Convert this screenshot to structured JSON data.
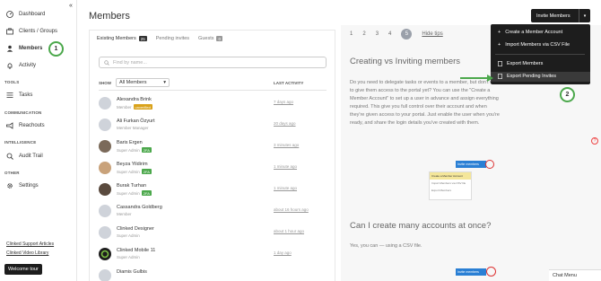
{
  "sidebar": {
    "items": [
      {
        "label": "Dashboard",
        "icon": "dashboard-icon"
      },
      {
        "label": "Clients / Groups",
        "icon": "briefcase-icon"
      },
      {
        "label": "Members",
        "icon": "user-icon"
      },
      {
        "label": "Activity",
        "icon": "bell-icon"
      }
    ],
    "sections": {
      "tools": {
        "label": "TOOLS",
        "items": [
          {
            "label": "Tasks",
            "icon": "list-icon"
          }
        ]
      },
      "communication": {
        "label": "COMMUNICATION",
        "items": [
          {
            "label": "Reachouts",
            "icon": "megaphone-icon"
          }
        ]
      },
      "intelligence": {
        "label": "INTELLIGENCE",
        "items": [
          {
            "label": "Audit Trail",
            "icon": "audit-icon"
          }
        ]
      },
      "other": {
        "label": "OTHER",
        "items": [
          {
            "label": "Settings",
            "icon": "gear-icon"
          }
        ]
      }
    },
    "links": [
      "Clinked Support Articles",
      "Clinked Video Library"
    ],
    "welcome": "Welcome tour",
    "step1": "1"
  },
  "main": {
    "title": "Members",
    "tabs": [
      {
        "label": "Existing Members",
        "count": "25"
      },
      {
        "label": "Pending invites",
        "count": ""
      },
      {
        "label": "Guests",
        "count": "0"
      }
    ],
    "search_placeholder": "Find by name...",
    "show_label": "SHOW",
    "show_value": "All Members",
    "last_activity_header": "LAST ACTIVITY",
    "members": [
      {
        "name": "Alexandra Brink",
        "role": "Member",
        "tag": "unverified",
        "last": "7 days ago"
      },
      {
        "name": "Ali Furkan Özyurt",
        "role": "Member Manager",
        "tag": "",
        "last": "20 days ago"
      },
      {
        "name": "Baris Ergen",
        "role": "Super Admin",
        "tag": "2FA",
        "last": "3 minutes ago"
      },
      {
        "name": "Beyza Yildirim",
        "role": "Super Admin",
        "tag": "2FA",
        "last": "1 minute ago"
      },
      {
        "name": "Burak Turhan",
        "role": "Super Admin",
        "tag": "2FA",
        "last": "1 minute ago"
      },
      {
        "name": "Cassandra Goldberg",
        "role": "Member",
        "tag": "",
        "last": "about 16 hours ago"
      },
      {
        "name": "Clinked Designer",
        "role": "Super Admin",
        "tag": "",
        "last": "about 1 hour ago"
      },
      {
        "name": "Clinked Mobile 11",
        "role": "Super Admin",
        "tag": "",
        "last": "1 day ago"
      },
      {
        "name": "Diamis Gulbis",
        "role": "",
        "tag": "",
        "last": ""
      }
    ]
  },
  "tips": {
    "pages": [
      "1",
      "2",
      "3",
      "4",
      "5"
    ],
    "current_page": "5",
    "hide": "Hide tips",
    "heading1": "Creating vs Inviting members",
    "para1": "Do you need to delegate tasks or events to a member, but don't want to give them access to the portal yet? You can use the \"Create a Member Account\" to set up a user in advance and assign everything required. This give you full control over their account and when they're given access to your portal. Just enable the user when you're ready, and share the login details you've created with them.",
    "heading2": "Can I create many accounts at once?",
    "para2": "Yes, you can — using a CSV file."
  },
  "invite": {
    "button": "Invite Members",
    "menu": [
      "Create a Member Account",
      "Import Members via CSV File",
      "Export Members",
      "Export Pending Invites"
    ],
    "step2": "2"
  },
  "mini": {
    "btn": "Invite members",
    "items": [
      "Create a Member Account",
      "Import Members via CSV file",
      "Export Members"
    ]
  },
  "chat": "Chat Menu"
}
